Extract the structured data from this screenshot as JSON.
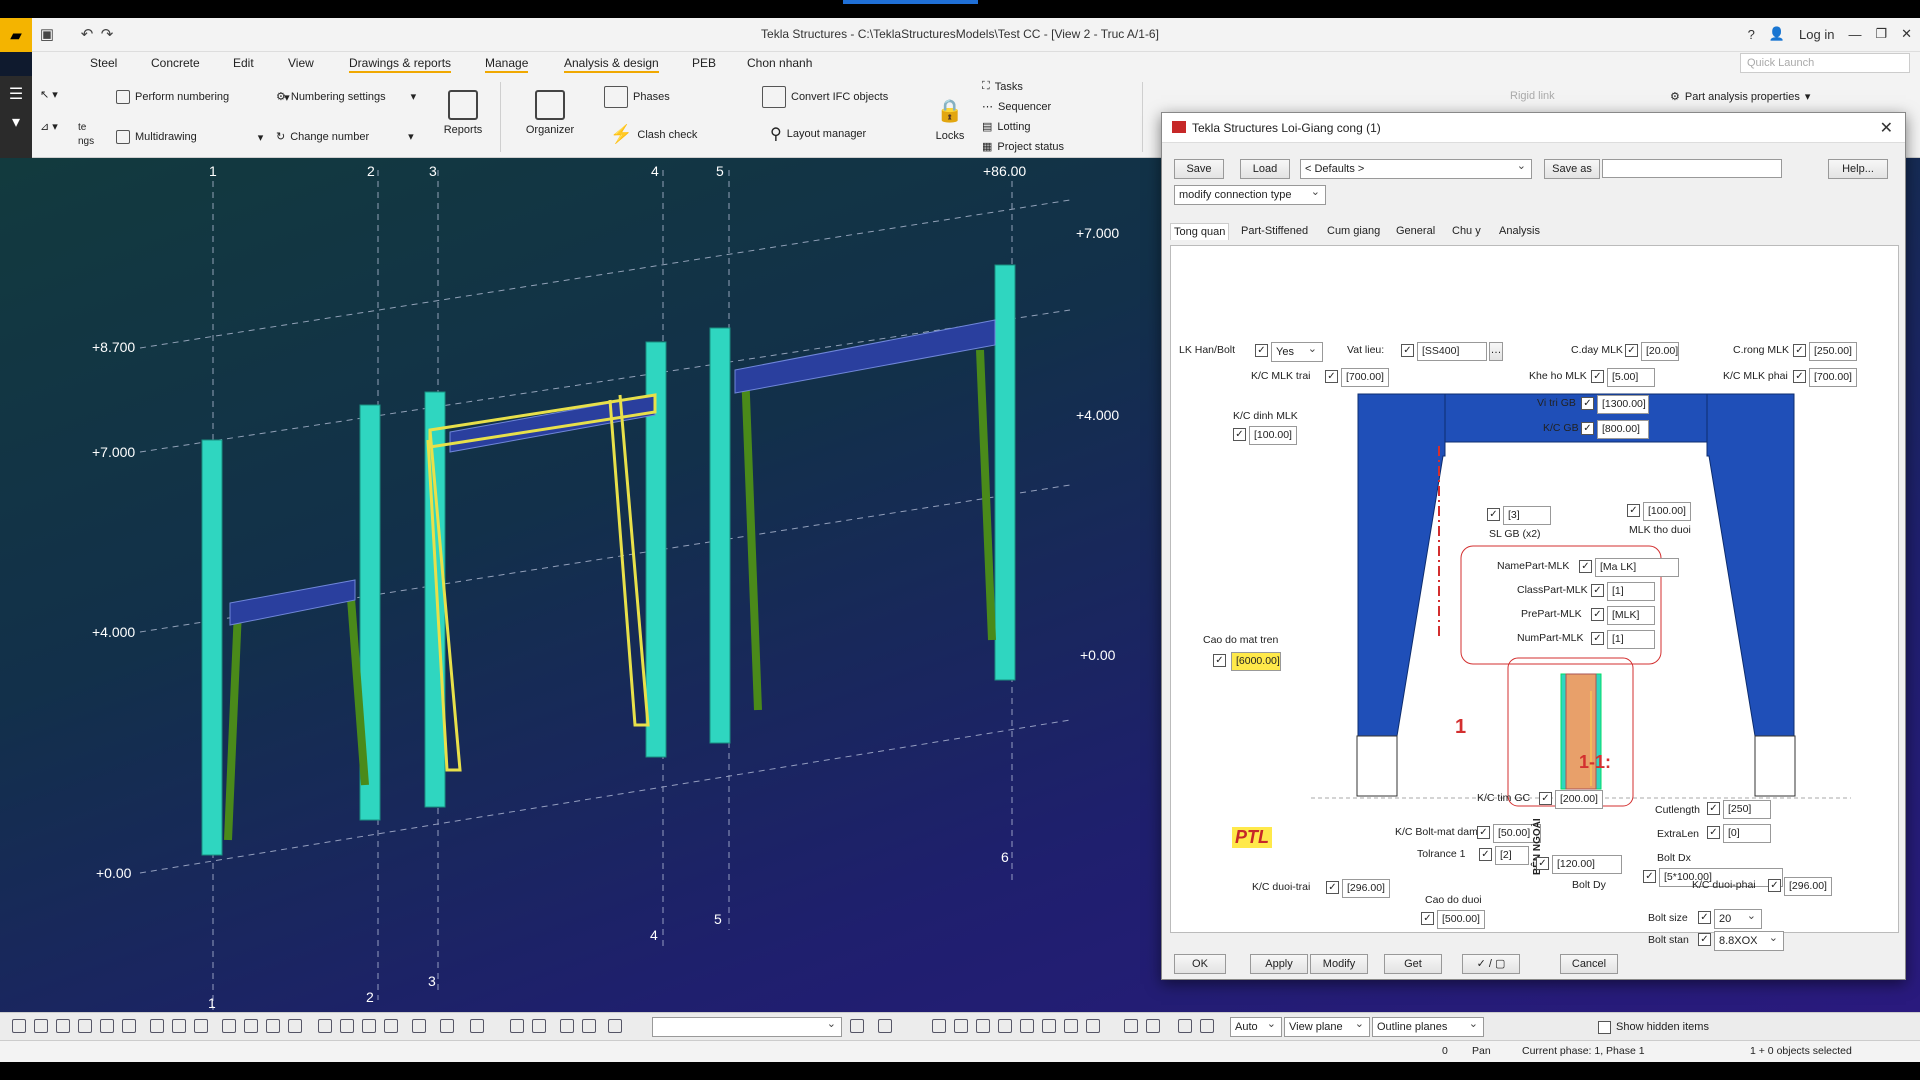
{
  "app": {
    "title": "Tekla Structures - C:\\TeklaStructuresModels\\Test CC  - [View 2 - Truc A/1-6]",
    "login": "Log in",
    "help_icon": "?",
    "quick_launch_placeholder": "Quick Launch"
  },
  "menu": {
    "tabs": [
      "Steel",
      "Concrete",
      "Edit",
      "View",
      "Drawings & reports",
      "Manage",
      "Analysis & design",
      "PEB",
      "Chon nhanh"
    ]
  },
  "ribbon": {
    "left_partial_1": "te",
    "left_partial_2": "ngs",
    "perform_numbering": "Perform numbering",
    "numbering_settings": "Numbering settings",
    "multidrawing": "Multidrawing",
    "change_number": "Change number",
    "reports": "Reports",
    "organizer": "Organizer",
    "phases": "Phases",
    "clash_check": "Clash check",
    "convert_ifc": "Convert IFC objects",
    "layout_manager": "Layout manager",
    "locks": "Locks",
    "tasks": "Tasks",
    "sequencer": "Sequencer",
    "lotting": "Lotting",
    "project_status": "Project status",
    "rigid_link": "Rigid link",
    "part_analysis_properties": "Part analysis properties"
  },
  "viewport": {
    "grid_labels_top": [
      "1",
      "2",
      "3",
      "4",
      "5",
      "6"
    ],
    "grid_label_top_6_combined": "+8.700",
    "grid_labels_bottom": [
      "1",
      "2",
      "3",
      "4",
      "5",
      "6"
    ],
    "left_levels": [
      "+8.700",
      "+7.000",
      "+4.000",
      "+0.00"
    ],
    "right_levels": [
      "+7.000",
      "+4.000",
      "+0.00"
    ]
  },
  "dialog": {
    "title": "Tekla Structures  Loi-Giang cong (1)",
    "save": "Save",
    "load": "Load",
    "defaults": "< Defaults >",
    "save_as": "Save as",
    "help": "Help...",
    "modify_type": "modify connection type",
    "tabs": [
      "Tong quan",
      "Part-Stiffened",
      "Cum giang",
      "General",
      "Chu y",
      "Analysis"
    ],
    "fields": {
      "lk_han_bolt_label": "LK Han/Bolt",
      "lk_han_bolt_value": "Yes",
      "vat_lieu_label": "Vat lieu:",
      "vat_lieu_value": "[SS400]",
      "c_day_label": "C.day MLK",
      "c_day_value": "[20.00]",
      "c_rong_label": "C.rong MLK",
      "c_rong_value": "[250.00]",
      "kc_mlk_trai_label": "K/C MLK trai",
      "kc_mlk_trai_value": "[700.00]",
      "khe_ho_label": "Khe ho MLK",
      "khe_ho_value": "[5.00]",
      "kc_mlk_phai_label": "K/C MLK phai",
      "kc_mlk_phai_value": "[700.00]",
      "kc_dinh_label": "K/C dinh MLK",
      "kc_dinh_value": "[100.00]",
      "vi_tri_gb_label": "Vi tri GB",
      "vi_tri_gb_value": "[1300.00]",
      "kc_gb_label": "K/C GB",
      "kc_gb_value": "[800.00]",
      "sl_gb_value": "[3]",
      "sl_gb_label": "SL GB (x2)",
      "mlk_tho_value": "[100.00]",
      "mlk_tho_label": "MLK tho duoi",
      "name_part_label": "NamePart-MLK",
      "name_part_value": "[Ma LK]",
      "class_part_label": "ClassPart-MLK",
      "class_part_value": "[1]",
      "pre_part_label": "PrePart-MLK",
      "pre_part_value": "[MLK]",
      "num_part_label": "NumPart-MLK",
      "num_part_value": "[1]",
      "cao_do_tren_label": "Cao do mat tren",
      "cao_do_tren_value": "[6000.00]",
      "section_label": "1-1:",
      "section_mark": "1",
      "kc_tim_label": "K/C tim GC",
      "kc_tim_value": "[200.00]",
      "cutlength_label": "Cutlength",
      "cutlength_value": "[250]",
      "kc_bolt_label": "K/C Bolt-mat dam",
      "kc_bolt_value": "[50.00]",
      "extralen_label": "ExtraLen",
      "extralen_value": "[0]",
      "tolrance_label": "Tolrance 1",
      "tolrance_value": "[2]",
      "bolt_dx_label": "Bolt Dx",
      "bolt_dx_value": "[5*100.00]",
      "cao_do_duoi_label": "Cao do duoi",
      "cao_do_duoi_value": "[500.00]",
      "ben_ngoai": "BÊN NGOÀI",
      "bolt_size_label": "Bolt size",
      "bolt_size_value": "20",
      "bolt_stan_label": "Bolt stan",
      "bolt_stan_value": "8.8XOX",
      "bolt_dy_value": "[120.00]",
      "bolt_dy_label": "Bolt Dy",
      "kc_duoi_trai_label": "K/C duoi-trai",
      "kc_duoi_trai_value": "[296.00]",
      "kc_duoi_phai_label": "K/C duoi-phai",
      "kc_duoi_phai_value": "[296.00]",
      "logo": "PTL"
    },
    "ok": "OK",
    "apply": "Apply",
    "modify": "Modify",
    "get": "Get",
    "toggle": "✓ / ▢",
    "cancel": "Cancel"
  },
  "bottom": {
    "snap_auto": "Auto",
    "view_plane": "View plane",
    "outline_planes": "Outline planes",
    "show_hidden": "Show hidden items"
  },
  "status": {
    "zero": "0",
    "pan": "Pan",
    "phase": "Current phase: 1, Phase 1",
    "selected": "1 + 0 objects selected"
  },
  "colors": {
    "accent": "#f0a800",
    "column": "#2fd6c0",
    "brace": "#4a8a1a",
    "beam": "#2a3f9e",
    "selected": "#e8e04a",
    "dialog_blue": "#1f4fb8"
  }
}
